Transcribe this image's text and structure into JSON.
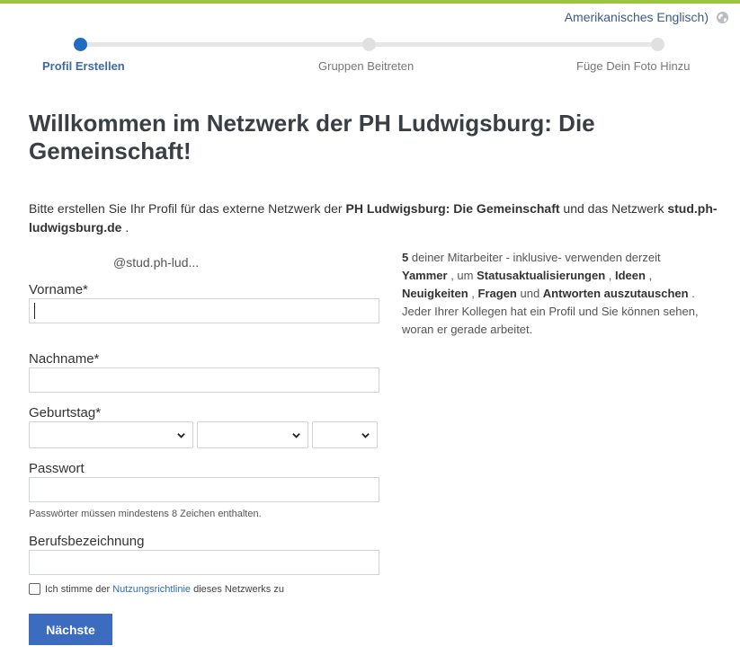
{
  "header": {
    "language_label": "Amerikanisches Englisch)",
    "language_icon": "globe-icon"
  },
  "steps": [
    {
      "label": "Profil Erstellen",
      "active": true
    },
    {
      "label": "Gruppen Beitreten",
      "active": false
    },
    {
      "label": "Füge Dein Foto Hinzu",
      "active": false
    }
  ],
  "title": "Willkommen im Netzwerk der PH Ludwigsburg: Die Gemeinschaft!",
  "intro": {
    "pre": "Bitte erstellen Sie Ihr Profil für das externe Netzwerk der ",
    "network_name": "PH Ludwigsburg: Die Gemeinschaft",
    "mid": " und das Netzwerk ",
    "domain": "stud.ph-ludwigsburg.de",
    "post": " ."
  },
  "email_hint": "@stud.ph-lud...",
  "form": {
    "first_name_label": "Vorname*",
    "first_name_value": "",
    "last_name_label": "Nachname*",
    "last_name_value": "",
    "birthday_label": "Geburtstag*",
    "password_label": "Passwort",
    "password_help": "Passwörter müssen mindestens 8 Zeichen enthalten.",
    "job_title_label": "Berufsbezeichnung",
    "job_title_value": "",
    "agree_pre": "Ich stimme der ",
    "agree_link": "Nutzungsrichtlinie",
    "agree_post": " dieses Netzwerks zu",
    "next_button": "Nächste"
  },
  "side": {
    "count": "5",
    "t1": " deiner Mitarbeiter - inklusive- verwenden derzeit ",
    "app": "Yammer",
    "t2": " , um ",
    "k1": "Statusaktualisierungen",
    "t3": " , ",
    "k2": "Ideen",
    "t4": " , ",
    "k3": "Neuigkeiten",
    "t5": " , ",
    "k4": "Fragen",
    "t6": " und ",
    "k5": "Antworten auszutauschen",
    "t7": " . Jeder Ihrer Kollegen hat ein Profil und Sie können sehen, woran er gerade arbeitet."
  },
  "colors": {
    "accent_bar": "#9bc53d",
    "primary": "#3b6cc0",
    "step_active": "#1f6ec1"
  }
}
